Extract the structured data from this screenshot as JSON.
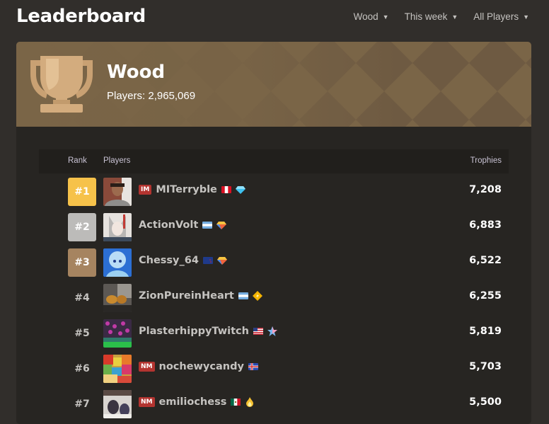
{
  "header": {
    "title": "Leaderboard",
    "filters": [
      {
        "label": "Wood",
        "icon": "caret-down-icon"
      },
      {
        "label": "This week",
        "icon": "caret-down-icon"
      },
      {
        "label": "All Players",
        "icon": "caret-down-icon"
      }
    ]
  },
  "banner": {
    "tier": "Wood",
    "players_label": "Players: 2,965,069",
    "icon": "trophy-icon",
    "color": "#7a6547"
  },
  "table": {
    "columns": {
      "rank": "Rank",
      "players": "Players",
      "trophies": "Trophies"
    },
    "rows": [
      {
        "rank": "#1",
        "rank_style": "gold",
        "title": "IM",
        "name": "MITerryble",
        "flag": "peru",
        "status": "diamond-icon",
        "trophies": "7,208"
      },
      {
        "rank": "#2",
        "rank_style": "silver",
        "title": "",
        "name": "ActionVolt",
        "flag": "argentina",
        "status": "rainbow-gem-icon",
        "trophies": "6,883"
      },
      {
        "rank": "#3",
        "rank_style": "bronze",
        "title": "",
        "name": "Chessy_64",
        "flag": "new-zealand",
        "status": "rainbow-gem-icon",
        "trophies": "6,522"
      },
      {
        "rank": "#4",
        "rank_style": "",
        "title": "",
        "name": "ZionPureinHeart",
        "flag": "argentina",
        "status": "lightning-gem-icon",
        "trophies": "6,255"
      },
      {
        "rank": "#5",
        "rank_style": "",
        "title": "",
        "name": "PlasterhippyTwitch",
        "flag": "usa",
        "status": "star-icon",
        "trophies": "5,819"
      },
      {
        "rank": "#6",
        "rank_style": "",
        "title": "NM",
        "name": "nochewycandy",
        "flag": "iceland",
        "status": "",
        "trophies": "5,703"
      },
      {
        "rank": "#7",
        "rank_style": "",
        "title": "NM",
        "name": "emiliochess",
        "flag": "mexico",
        "status": "flame-icon",
        "trophies": "5,500"
      }
    ]
  },
  "colors": {
    "background": "#312e2b",
    "panel": "#272522",
    "gold": "#f6c24a",
    "silver": "#bcbbb9",
    "bronze": "#a68460",
    "title_badge": "#b33430"
  }
}
